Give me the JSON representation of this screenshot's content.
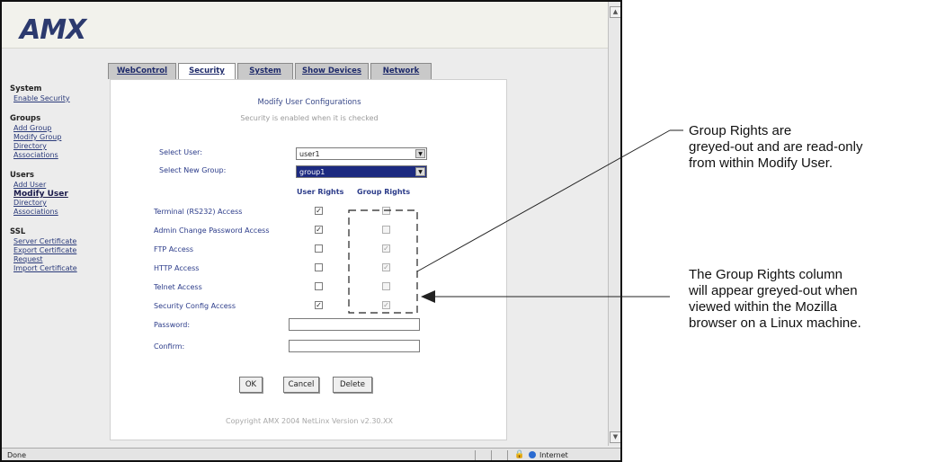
{
  "logo": "AMX",
  "tabs": [
    "WebControl",
    "Security",
    "System",
    "Show Devices",
    "Network"
  ],
  "nav": [
    {
      "head": "System",
      "links": [
        "Enable Security"
      ]
    },
    {
      "head": "Groups",
      "links": [
        "Add Group",
        "Modify Group",
        "Directory",
        "Associations"
      ]
    },
    {
      "head": "Users",
      "links": [
        "Add User",
        "Modify User",
        "Directory",
        "Associations"
      ]
    },
    {
      "head": "SSL",
      "links": [
        "Server Certificate",
        "Export Certificate",
        "Request",
        "Import Certificate"
      ]
    }
  ],
  "form": {
    "title": "Modify User Configurations",
    "subtitle": "Security is enabled when it is checked",
    "select_user_label": "Select User:",
    "select_user_value": "user1",
    "select_group_label": "Select New Group:",
    "select_group_value": "group1",
    "col_user_rights": "User Rights",
    "col_group_rights": "Group Rights",
    "rows": [
      {
        "label": "Terminal (RS232) Access",
        "user": true,
        "group": false
      },
      {
        "label": "Admin Change Password Access",
        "user": true,
        "group": false
      },
      {
        "label": "FTP Access",
        "user": false,
        "group": true
      },
      {
        "label": "HTTP Access",
        "user": false,
        "group": true
      },
      {
        "label": "Telnet Access",
        "user": false,
        "group": false
      },
      {
        "label": "Security Config Access",
        "user": true,
        "group": true
      }
    ],
    "password_label": "Password:",
    "confirm_label": "Confirm:",
    "ok": "OK",
    "cancel": "Cancel",
    "delete": "Delete",
    "copyright": "Copyright AMX 2004   NetLinx Version v2.30.XX"
  },
  "status": {
    "left": "Done",
    "zone": "Internet"
  },
  "callouts": {
    "top": [
      "Group Rights are",
      "greyed-out and are read-only",
      "from within Modify User."
    ],
    "bottom": [
      "The Group Rights column",
      "will appear greyed-out when",
      "viewed within the Mozilla",
      "browser on a Linux machine."
    ]
  }
}
